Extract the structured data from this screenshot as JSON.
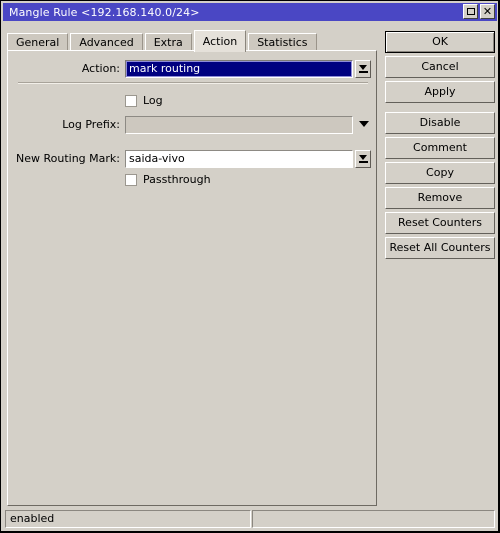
{
  "window": {
    "title": "Mangle Rule <192.168.140.0/24>",
    "controls": [
      {
        "name": "maximize-button",
        "glyph": "maximize"
      },
      {
        "name": "close-button",
        "glyph": "close"
      }
    ]
  },
  "tabs": [
    {
      "label": "General",
      "active": false
    },
    {
      "label": "Advanced",
      "active": false
    },
    {
      "label": "Extra",
      "active": false
    },
    {
      "label": "Action",
      "active": true
    },
    {
      "label": "Statistics",
      "active": false
    }
  ],
  "form": {
    "action": {
      "label": "Action:",
      "value": "mark routing",
      "dropdown_icon": "chevron-down-bar-icon"
    },
    "log": {
      "label": "Log",
      "checked": false
    },
    "log_prefix": {
      "label": "Log Prefix:",
      "value": "",
      "placeholder": "",
      "disabled": true,
      "dropdown_icon": "triangle-down-icon"
    },
    "new_routing_mark": {
      "label": "New Routing Mark:",
      "value": "saida-vivo",
      "dropdown_icon": "chevron-down-bar-icon"
    },
    "passthrough": {
      "label": "Passthrough",
      "checked": false
    }
  },
  "buttons": [
    {
      "label": "OK",
      "focused": true,
      "gap": false
    },
    {
      "label": "Cancel",
      "focused": false,
      "gap": false
    },
    {
      "label": "Apply",
      "focused": false,
      "gap": false
    },
    {
      "label": "Disable",
      "focused": false,
      "gap": true
    },
    {
      "label": "Comment",
      "focused": false,
      "gap": false
    },
    {
      "label": "Copy",
      "focused": false,
      "gap": false
    },
    {
      "label": "Remove",
      "focused": false,
      "gap": false
    },
    {
      "label": "Reset Counters",
      "focused": false,
      "gap": false
    },
    {
      "label": "Reset All Counters",
      "focused": false,
      "gap": false
    }
  ],
  "statusbar": {
    "left": "enabled",
    "right": ""
  },
  "colors": {
    "titlebar": "#4a47c4",
    "window_face": "#d4d0c8",
    "selection": "#000080",
    "tab_active": "#e5e1da"
  }
}
